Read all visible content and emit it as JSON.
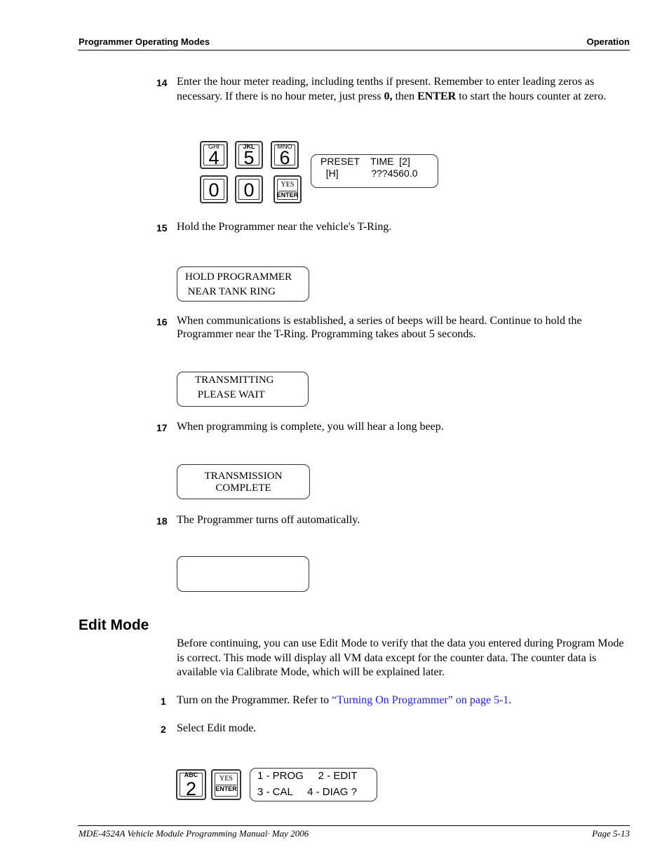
{
  "header": {
    "left": "Programmer Operating Modes",
    "right": "Operation"
  },
  "steps": [
    {
      "num": "14",
      "text_parts": [
        {
          "t": "Enter the hour meter reading, including tenths if present. Remember to enter leading zeros as necessary. If there is no hour meter, just press "
        },
        {
          "t": "0,",
          "b": true
        },
        {
          "t": " then "
        },
        {
          "t": "ENTER",
          "b": true
        },
        {
          "t": " to start the hours counter at zero."
        }
      ]
    },
    {
      "num": "15",
      "text": "Hold the Programmer near the vehicle's T-Ring."
    },
    {
      "num": "16",
      "text": "When communications is established, a series of beeps will be heard. Continue to hold the Programmer near the T-Ring. Programming takes about 5 seconds."
    },
    {
      "num": "17",
      "text": "When programming is complete, you will hear a long beep."
    },
    {
      "num": "18",
      "text": "The Programmer turns off automatically."
    }
  ],
  "keypad14": [
    {
      "digit": "4",
      "letters": "GHI"
    },
    {
      "digit": "5",
      "letters": "JKL"
    },
    {
      "digit": "6",
      "letters": "MNO"
    },
    {
      "digit": "0",
      "letters": ""
    },
    {
      "digit": "0",
      "letters": ""
    },
    {
      "yes": "YES",
      "enter": "ENTER"
    }
  ],
  "displays": {
    "preset": {
      "line1": "PRESET    TIME  [2]",
      "line2": "  [H]            ???4560.0"
    },
    "hold": {
      "line1": "HOLD PROGRAMMER",
      "line2": " NEAR TANK RING"
    },
    "transmitting": {
      "line1": "TRANSMITTING",
      "line2": " PLEASE WAIT"
    },
    "complete": {
      "line1": "TRANSMISSION",
      "line2": "COMPLETE"
    },
    "off": {
      "line1": "",
      "line2": ""
    },
    "menu": {
      "line1": "1 - PROG     2 - EDIT",
      "line2": "3 - CAL     4 - DIAG ?"
    }
  },
  "edit_mode": {
    "heading": "Edit Mode",
    "intro": "Before continuing, you can use Edit Mode to verify that the data you entered during Program Mode is correct. This mode will display all VM data except for the counter data. The counter data is available via Calibrate Mode, which will be explained later.",
    "steps": [
      {
        "num": "1",
        "pre": "Turn on the Programmer. Refer to ",
        "link": "“Turning On Programmer” on page 5-1",
        "post": "."
      },
      {
        "num": "2",
        "text": "Select Edit mode."
      }
    ],
    "keypad": [
      {
        "digit": "2",
        "letters": "ABC"
      },
      {
        "yes": "YES",
        "enter": "ENTER"
      }
    ]
  },
  "footer": {
    "left": "MDE-4524A Vehicle Module Programming Manual· May 2006",
    "right": "Page 5-13"
  },
  "colors": {
    "link": "#1a1aff"
  }
}
